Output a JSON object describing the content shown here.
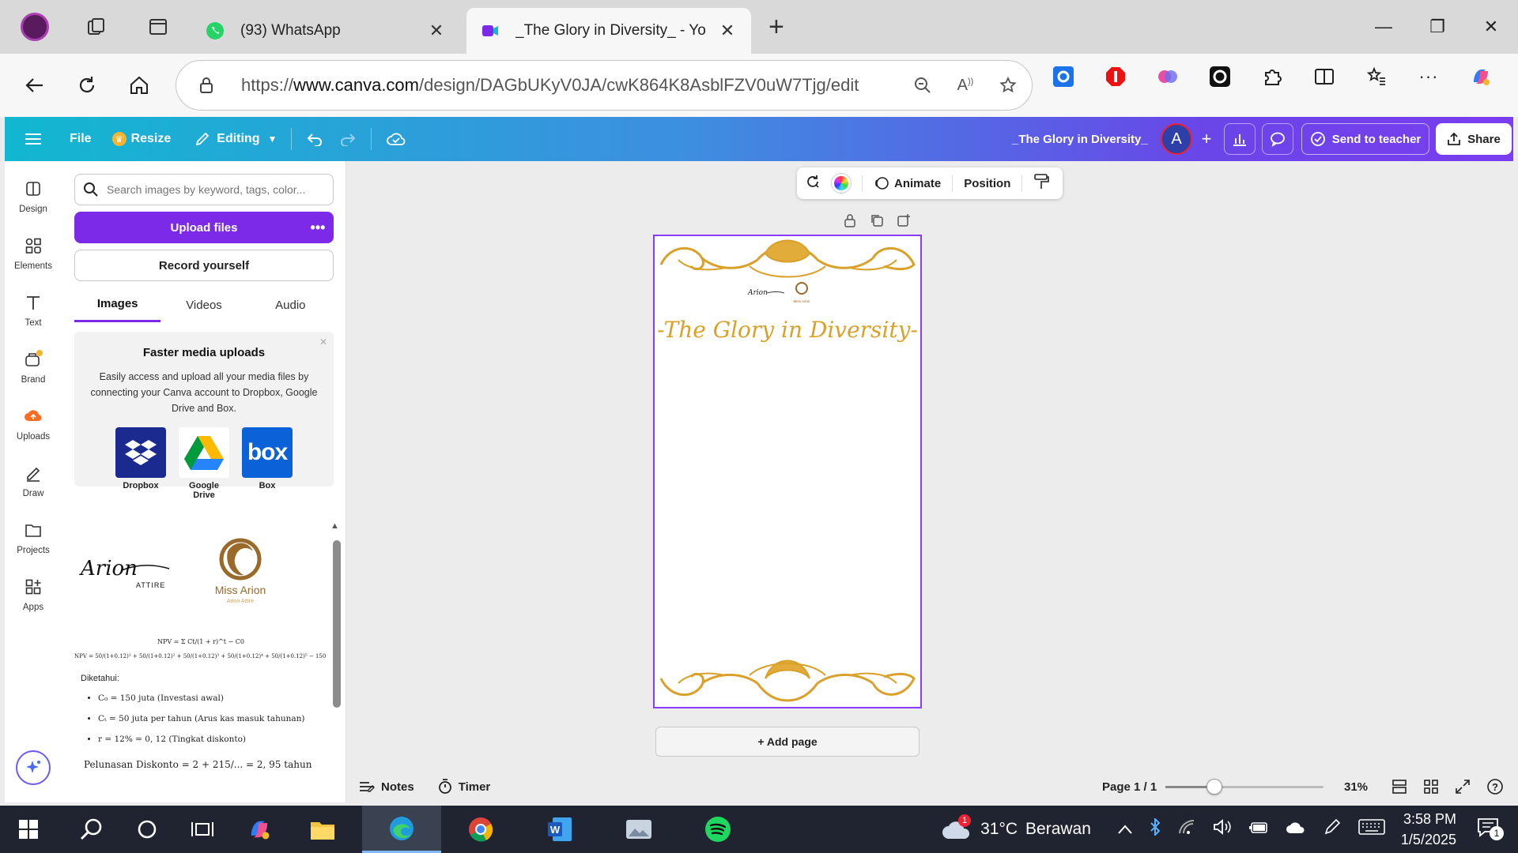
{
  "browser": {
    "tabs": [
      {
        "title": "(93) WhatsApp",
        "active": false,
        "favicon": "whatsapp-icon"
      },
      {
        "title": "_The Glory in Diversity_ - Yo",
        "active": true,
        "favicon": "canva-icon"
      }
    ],
    "url_prefix": "https://",
    "url_host": "www.canva.com",
    "url_path": "/design/DAGbUKyV0JA/cwK864K8AsblFZV0uW7Tjg/edit"
  },
  "canva_header": {
    "file": "File",
    "resize": "Resize",
    "editing": "Editing",
    "design_title": "_The Glory in Diversity_",
    "avatar_letter": "A",
    "send_to_teacher": "Send to teacher",
    "share": "Share"
  },
  "rail": {
    "items": [
      {
        "label": "Design",
        "icon": "design-icon"
      },
      {
        "label": "Elements",
        "icon": "elements-icon"
      },
      {
        "label": "Text",
        "icon": "text-icon"
      },
      {
        "label": "Brand",
        "icon": "brand-icon"
      },
      {
        "label": "Uploads",
        "icon": "uploads-icon"
      },
      {
        "label": "Draw",
        "icon": "draw-icon"
      },
      {
        "label": "Projects",
        "icon": "projects-icon"
      },
      {
        "label": "Apps",
        "icon": "apps-icon"
      }
    ]
  },
  "panel": {
    "search_placeholder": "Search images by keyword, tags, color...",
    "upload_files": "Upload files",
    "record_yourself": "Record yourself",
    "tabs": [
      "Images",
      "Videos",
      "Audio"
    ],
    "promo_title": "Faster media uploads",
    "promo_text": "Easily access and upload all your media files by connecting your Canva account to Dropbox, Google Drive and Box.",
    "providers": [
      "Dropbox",
      "Google Drive",
      "Box"
    ],
    "thumb_logo_text": "Arion",
    "thumb_logo_sub": "ATTIRE",
    "thumb_logo2_text": "Miss Arion",
    "thumb_logo2_sub": "Arion Attire",
    "math": {
      "formula1": "NPV = Σ Ct/(1 + r)^t − C0",
      "formula2": "NPV = 50/(1+0.12)¹ + 50/(1+0.12)² + 50/(1+0.12)³ + 50/(1+0.12)⁴ + 50/(1+0.12)⁵ − 150",
      "known_label": "Diketahui:",
      "bullets": [
        "C₀ = 150 juta (Investasi awal)",
        "Cₜ = 50 juta per tahun (Arus kas masuk tahunan)",
        "r = 12% = 0, 12 (Tingkat diskonto)"
      ],
      "payback": "Pelunasan Diskonto = 2 + 215/... = 2, 95 tahun"
    }
  },
  "context_toolbar": {
    "animate": "Animate",
    "position": "Position"
  },
  "page": {
    "title": "-The Glory in Diversity-",
    "brand": "Arion",
    "brand_sub": "Miss Arion"
  },
  "add_page": "+ Add page",
  "footer": {
    "notes": "Notes",
    "timer": "Timer",
    "page_indicator": "Page 1 / 1",
    "zoom": "31%",
    "zoom_fraction": 0.31
  },
  "taskbar": {
    "temperature": "31°C",
    "weather": "Berawan",
    "weather_badge": "1",
    "time": "3:58 PM",
    "date": "1/5/2025",
    "notif_count": "1"
  },
  "colors": {
    "accent_purple": "#7d2ae8",
    "ornament_gold": "#d9a02a"
  }
}
